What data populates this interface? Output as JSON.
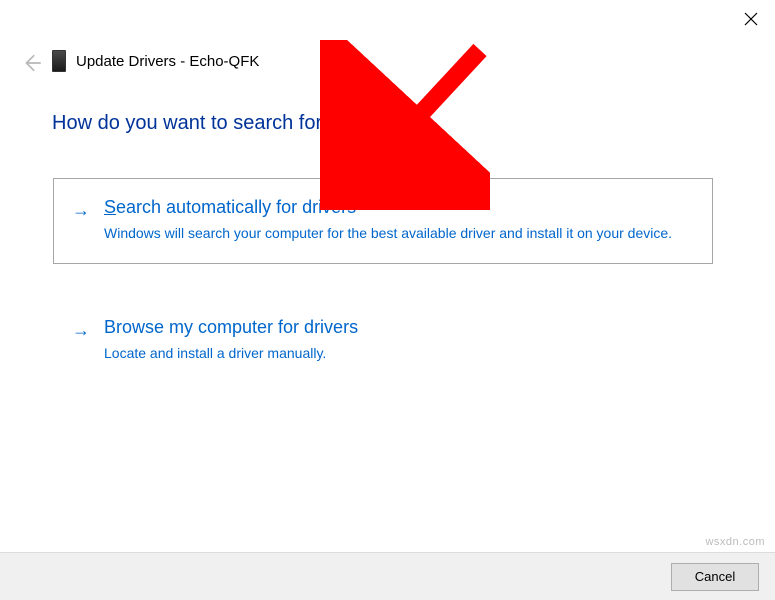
{
  "window": {
    "title": "Update Drivers - Echo-QFK"
  },
  "heading": "How do you want to search for drivers?",
  "options": [
    {
      "title": "Search automatically for drivers",
      "desc": "Windows will search your computer for the best available driver and install it on your device."
    },
    {
      "title": "Browse my computer for drivers",
      "desc": "Locate and install a driver manually."
    }
  ],
  "footer": {
    "cancel": "Cancel"
  },
  "watermark": "wsxdn.com"
}
